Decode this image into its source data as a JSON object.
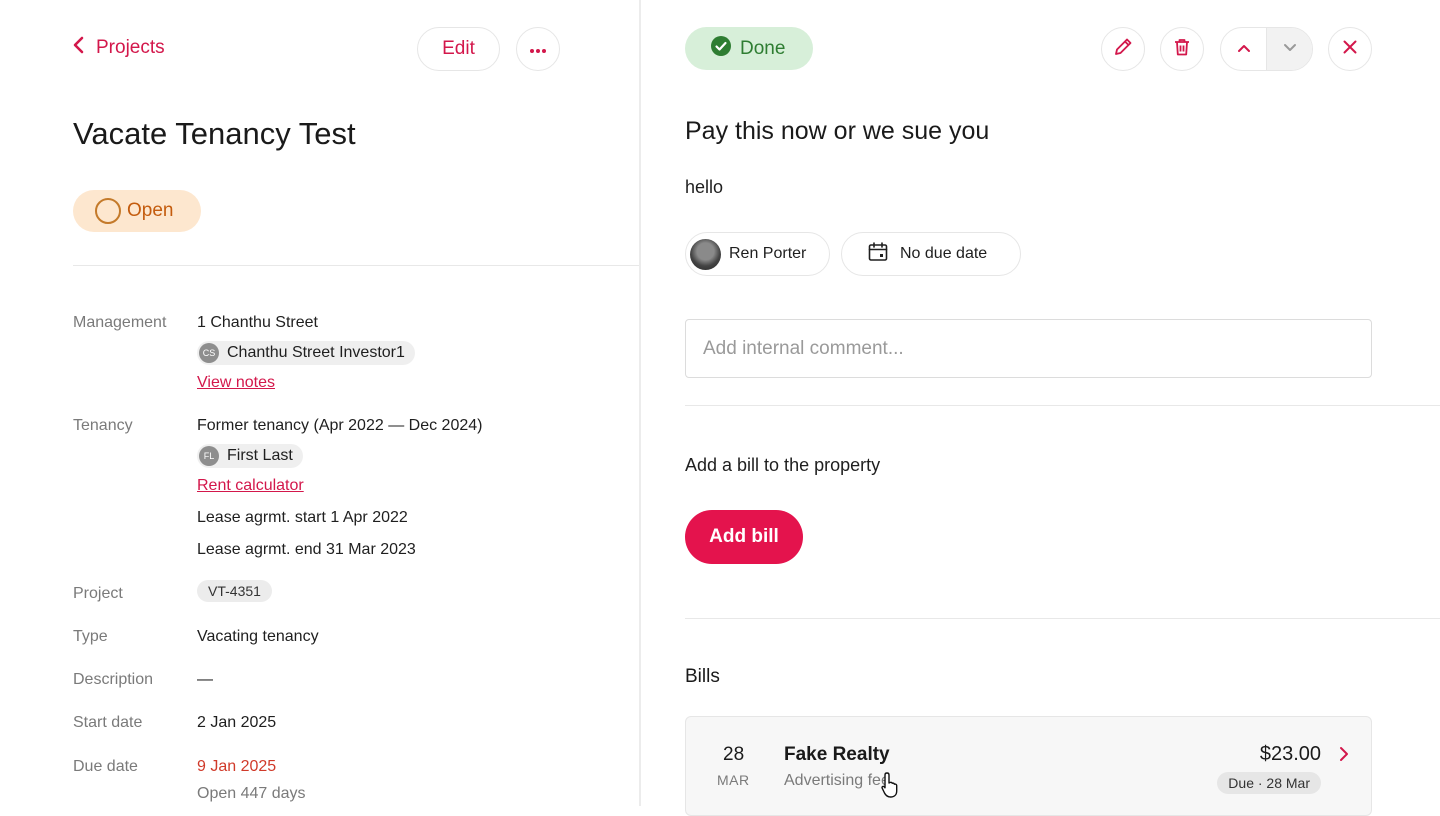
{
  "colors": {
    "accent": "#d3174b",
    "open_bg": "#fde7cf",
    "done_bg": "#d7efd9",
    "due_red": "#d03a2a"
  },
  "nav": {
    "back_label": "Projects",
    "back_icon": "chevron-left-icon"
  },
  "header": {
    "edit_label": "Edit",
    "more_icon": "more-horizontal-icon"
  },
  "project": {
    "title": "Vacate Tenancy Test",
    "status": "Open",
    "fields": {
      "management_label": "Management",
      "management_address": "1 Chanthu Street",
      "management_chip_initials": "CS",
      "management_chip_name": "Chanthu Street Investor1",
      "management_link": "View notes",
      "tenancy_label": "Tenancy",
      "tenancy_value": "Former tenancy (Apr 2022 — Dec 2024)",
      "tenancy_chip_initials": "FL",
      "tenancy_chip_name": "First Last",
      "tenancy_link": "Rent calculator",
      "lease_start": "Lease agrmt. start 1 Apr 2022",
      "lease_end": "Lease agrmt. end 31 Mar 2023",
      "project_label": "Project",
      "project_value": "VT-4351",
      "type_label": "Type",
      "type_value": "Vacating tenancy",
      "description_label": "Description",
      "description_value": "—",
      "start_label": "Start date",
      "start_value": "2 Jan 2025",
      "due_label": "Due date",
      "due_value": "9 Jan 2025",
      "open_days": "Open 447 days"
    }
  },
  "task": {
    "status": "Done",
    "title": "Pay this now or we sue you",
    "body": "hello",
    "assignee": "Ren Porter",
    "due": "No due date",
    "comment_placeholder": "Add internal comment...",
    "bill_prompt": "Add a bill to the property",
    "add_bill_label": "Add bill",
    "bills_heading": "Bills",
    "bills": [
      {
        "day": "28",
        "month": "MAR",
        "name": "Fake Realty",
        "category": "Advertising fee",
        "amount": "$23.00",
        "due": "Due · 28 Mar"
      }
    ]
  }
}
